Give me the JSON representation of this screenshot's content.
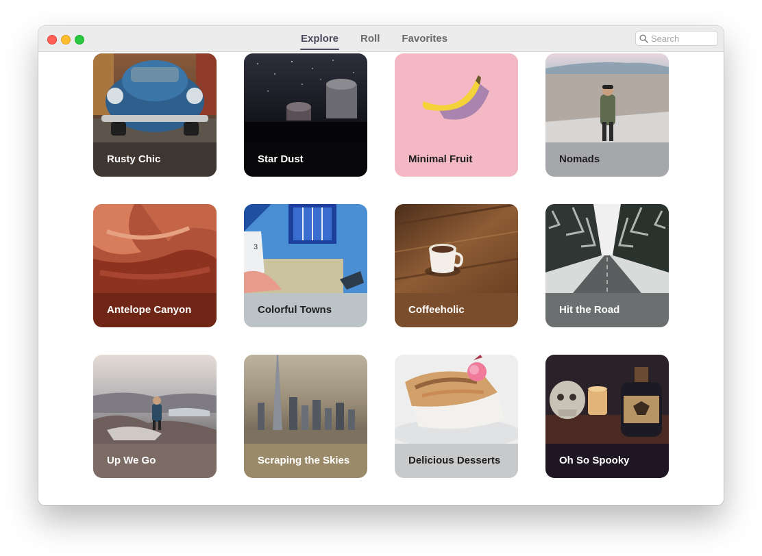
{
  "window": {
    "tabs": [
      {
        "label": "Explore",
        "active": true
      },
      {
        "label": "Roll",
        "active": false
      },
      {
        "label": "Favorites",
        "active": false
      }
    ],
    "search": {
      "placeholder": "Search",
      "value": ""
    }
  },
  "cards": [
    {
      "title": "Rusty Chic",
      "band_color": "#3e3630",
      "text_color": "#ffffff"
    },
    {
      "title": "Star Dust",
      "band_color": "#070709",
      "text_color": "#ffffff"
    },
    {
      "title": "Minimal Fruit",
      "band_color": "#f4b8c5",
      "text_color": "#1e1e1e"
    },
    {
      "title": "Nomads",
      "band_color": "#a6a7ab",
      "text_color": "#1e1e1e"
    },
    {
      "title": "Antelope Canyon",
      "band_color": "#6f2617",
      "text_color": "#ffffff"
    },
    {
      "title": "Colorful Towns",
      "band_color": "#bcc3c6",
      "text_color": "#1e1e1e"
    },
    {
      "title": "Coffeeholic",
      "band_color": "#7a4d2c",
      "text_color": "#ffffff"
    },
    {
      "title": "Hit the Road",
      "band_color": "#6c6f70",
      "text_color": "#ffffff"
    },
    {
      "title": "Up We Go",
      "band_color": "#7c6c65",
      "text_color": "#ffffff"
    },
    {
      "title": "Scraping the Skies",
      "band_color": "#9a8a69",
      "text_color": "#ffffff"
    },
    {
      "title": "Delicious Desserts",
      "band_color": "#c8c9ca",
      "text_color": "#1e1e1e"
    },
    {
      "title": "Oh So Spooky",
      "band_color": "#1f1623",
      "text_color": "#ffffff"
    }
  ],
  "colors": {
    "accent": "#4a4a5e",
    "titlebar": "#ececec",
    "close": "#fe5f57",
    "minimize": "#febc2e",
    "zoom": "#28c840"
  }
}
